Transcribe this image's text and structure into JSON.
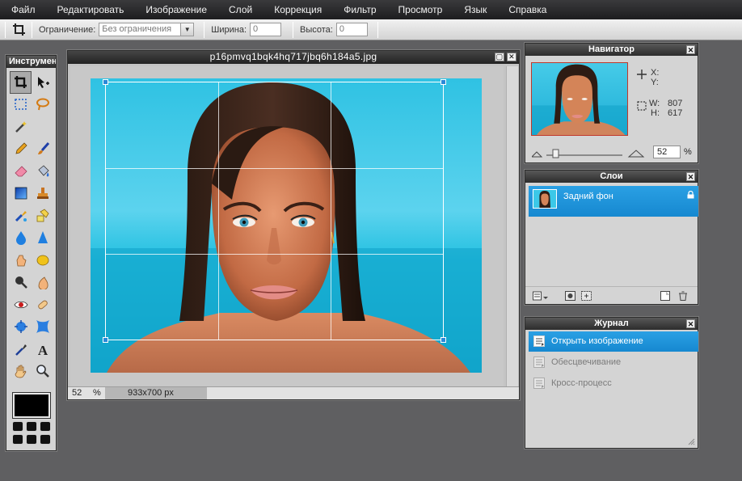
{
  "menu": [
    "Файл",
    "Редактировать",
    "Изображение",
    "Слой",
    "Коррекция",
    "Фильтр",
    "Просмотр",
    "Язык",
    "Справка"
  ],
  "options": {
    "constraint_label": "Ограничение:",
    "constraint_value": "Без ограничения",
    "width_label": "Ширина:",
    "width_value": "0",
    "height_label": "Высота:",
    "height_value": "0"
  },
  "tools": {
    "title": "Инструменты",
    "items": [
      "crop-icon",
      "move-icon",
      "marquee-icon",
      "lasso-icon",
      "magic-wand-icon",
      "empty",
      "pencil-icon",
      "brush-icon",
      "eraser-icon",
      "paint-bucket-icon",
      "gradient-icon",
      "clone-stamp-icon",
      "color-replace-icon",
      "drawing-icon",
      "blur-icon",
      "sharpen-icon",
      "smudge-icon",
      "sponge-icon",
      "dodge-icon",
      "burn-icon",
      "red-eye-icon",
      "spot-heal-icon",
      "bloat-icon",
      "pinch-icon",
      "color-picker-icon",
      "type-icon",
      "hand-icon",
      "zoom-icon"
    ]
  },
  "document": {
    "title": "p16pmvq1bqk4hq717jbq6h184a5.jpg",
    "zoom": "52",
    "zoom_unit": "%",
    "dimensions": "933x700 px"
  },
  "navigator": {
    "title": "Навигатор",
    "x_label": "X:",
    "y_label": "Y:",
    "w_label": "W:",
    "w_value": "807",
    "h_label": "H:",
    "h_value": "617",
    "zoom": "52",
    "zoom_unit": "%"
  },
  "layers": {
    "title": "Слои",
    "items": [
      {
        "label": "Задний фон"
      }
    ]
  },
  "history": {
    "title": "Журнал",
    "items": [
      {
        "label": "Открыть изображение"
      },
      {
        "label": "Обесцвечивание"
      },
      {
        "label": "Кросс-процесс"
      }
    ]
  },
  "colors": {
    "accent": "#1a8ed6",
    "handle": "#2a8ad8",
    "foreground": "#000000"
  }
}
